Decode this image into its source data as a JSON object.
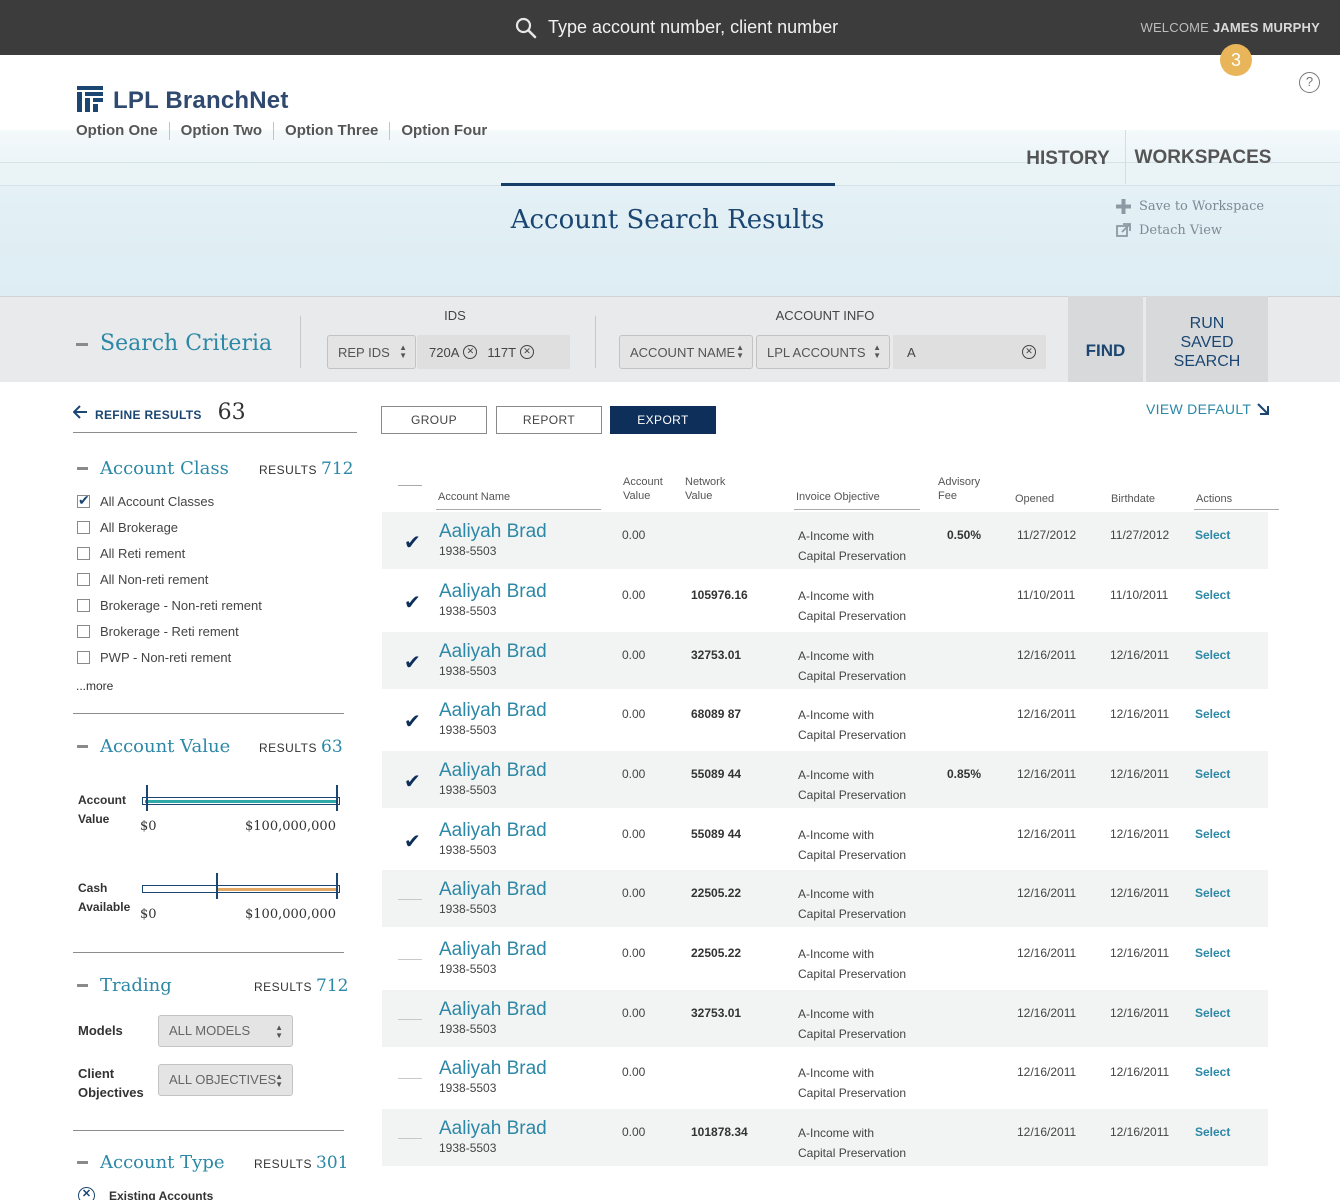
{
  "topbar": {
    "search_placeholder": "Type account number, client number",
    "welcome_prefix": "WELCOME",
    "user_name": "JAMES MURPHY",
    "notification_count": "3",
    "help_label": "?"
  },
  "header": {
    "logo_text": "LPL BranchNet",
    "nav": [
      "Option One",
      "Option Two",
      "Option Three",
      "Option Four"
    ],
    "tabs": {
      "history": "HISTORY",
      "workspaces": "WORKSPACES"
    },
    "page_title": "Account Search Results",
    "actions": {
      "save": "Save to Workspace",
      "detach": "Detach View"
    }
  },
  "criteria": {
    "label": "Search Criteria",
    "ids_label": "IDS",
    "account_info_label": "ACCOUNT INFO",
    "rep_ids_select": "REP IDS",
    "rep_ids": [
      "720A",
      "117T"
    ],
    "account_name_select": "ACCOUNT NAME",
    "lpl_accounts_select": "LPL ACCOUNTS",
    "account_query": "A",
    "find": "FIND",
    "run_saved": [
      "RUN",
      "SAVED",
      "SEARCH"
    ]
  },
  "refine": {
    "label": "REFINE RESULTS",
    "count": "63",
    "results_label": "RESULTS",
    "account_class": {
      "title": "Account Class",
      "count": "712",
      "options": [
        {
          "label": "All Account Classes",
          "checked": true
        },
        {
          "label": "All Brokerage",
          "checked": false
        },
        {
          "label": "All Reti rement",
          "checked": false
        },
        {
          "label": "All Non-reti rement",
          "checked": false
        },
        {
          "label": "Brokerage - Non-reti rement",
          "checked": false
        },
        {
          "label": "Brokerage - Reti rement",
          "checked": false
        },
        {
          "label": "PWP - Non-reti rement",
          "checked": false
        }
      ],
      "more": "...more"
    },
    "account_value": {
      "title": "Account Value",
      "count": "63",
      "ranges": [
        {
          "label1": "Account",
          "label2": "Value",
          "min": "$0",
          "max": "$100,000,000",
          "low": 0.0,
          "high": 1.0,
          "color": "#2fa8a8"
        },
        {
          "label1": "Cash",
          "label2": "Available",
          "min": "$0",
          "max": "$100,000,000",
          "low": 0.37,
          "high": 1.0,
          "color": "#e3a862"
        }
      ]
    },
    "trading": {
      "title": "Trading",
      "count": "712",
      "models_label": "Models",
      "models_value": "ALL MODELS",
      "objectives_label1": "Client",
      "objectives_label2": "Objectives",
      "objectives_value": "ALL OBJECTIVES"
    },
    "account_type": {
      "title": "Account Type",
      "count": "301",
      "first_option": "Existing Accounts"
    }
  },
  "toolbar": {
    "group": "GROUP",
    "report": "REPORT",
    "export": "EXPORT",
    "view_default": "VIEW DEFAULT"
  },
  "table": {
    "headers": {
      "account_name": "Account Name",
      "account_value": [
        "Account",
        "Value"
      ],
      "network_value": [
        "Network",
        "Value"
      ],
      "invoice_objective": "Invoice Objective",
      "advisory_fee": [
        "Advisory",
        "Fee"
      ],
      "opened": "Opened",
      "birthdate": "Birthdate",
      "actions": "Actions"
    },
    "rows": [
      {
        "checked": true,
        "name": "Aaliyah Brad",
        "number": "1938-5503",
        "account_value": "0.00",
        "network_value": "",
        "objective1": "A-Income with",
        "objective2": "Capital Preservation",
        "fee": "0.50%",
        "opened": "11/27/2012",
        "birthdate": "11/27/2012",
        "action": "Select"
      },
      {
        "checked": true,
        "name": "Aaliyah Brad",
        "number": "1938-5503",
        "account_value": "0.00",
        "network_value": "105976.16",
        "objective1": "A-Income with",
        "objective2": "Capital Preservation",
        "fee": "",
        "opened": "11/10/2011",
        "birthdate": "11/10/2011",
        "action": "Select"
      },
      {
        "checked": true,
        "name": "Aaliyah Brad",
        "number": "1938-5503",
        "account_value": "0.00",
        "network_value": "32753.01",
        "objective1": "A-Income with",
        "objective2": "Capital Preservation",
        "fee": "",
        "opened": "12/16/2011",
        "birthdate": "12/16/2011",
        "action": "Select"
      },
      {
        "checked": true,
        "name": "Aaliyah Brad",
        "number": "1938-5503",
        "account_value": "0.00",
        "network_value": "68089 87",
        "objective1": "A-Income with",
        "objective2": "Capital Preservation",
        "fee": "",
        "opened": "12/16/2011",
        "birthdate": "12/16/2011",
        "action": "Select"
      },
      {
        "checked": true,
        "name": "Aaliyah Brad",
        "number": "1938-5503",
        "account_value": "0.00",
        "network_value": "55089 44",
        "objective1": "A-Income with",
        "objective2": "Capital Preservation",
        "fee": "0.85%",
        "opened": "12/16/2011",
        "birthdate": "12/16/2011",
        "action": "Select"
      },
      {
        "checked": true,
        "name": "Aaliyah Brad",
        "number": "1938-5503",
        "account_value": "0.00",
        "network_value": "55089 44",
        "objective1": "A-Income with",
        "objective2": "Capital Preservation",
        "fee": "",
        "opened": "12/16/2011",
        "birthdate": "12/16/2011",
        "action": "Select"
      },
      {
        "checked": false,
        "name": "Aaliyah Brad",
        "number": "1938-5503",
        "account_value": "0.00",
        "network_value": "22505.22",
        "objective1": "A-Income with",
        "objective2": "Capital Preservation",
        "fee": "",
        "opened": "12/16/2011",
        "birthdate": "12/16/2011",
        "action": "Select"
      },
      {
        "checked": false,
        "name": "Aaliyah Brad",
        "number": "1938-5503",
        "account_value": "0.00",
        "network_value": "22505.22",
        "objective1": "A-Income with",
        "objective2": "Capital Preservation",
        "fee": "",
        "opened": "12/16/2011",
        "birthdate": "12/16/2011",
        "action": "Select"
      },
      {
        "checked": false,
        "name": "Aaliyah Brad",
        "number": "1938-5503",
        "account_value": "0.00",
        "network_value": "32753.01",
        "objective1": "A-Income with",
        "objective2": "Capital Preservation",
        "fee": "",
        "opened": "12/16/2011",
        "birthdate": "12/16/2011",
        "action": "Select"
      },
      {
        "checked": false,
        "name": "Aaliyah Brad",
        "number": "1938-5503",
        "account_value": "0.00",
        "network_value": "",
        "objective1": "A-Income with",
        "objective2": "Capital Preservation",
        "fee": "",
        "opened": "12/16/2011",
        "birthdate": "12/16/2011",
        "action": "Select"
      },
      {
        "checked": false,
        "name": "Aaliyah Brad",
        "number": "1938-5503",
        "account_value": "0.00",
        "network_value": "101878.34",
        "objective1": "A-Income with",
        "objective2": "Capital Preservation",
        "fee": "",
        "opened": "12/16/2011",
        "birthdate": "12/16/2011",
        "action": "Select"
      }
    ]
  }
}
